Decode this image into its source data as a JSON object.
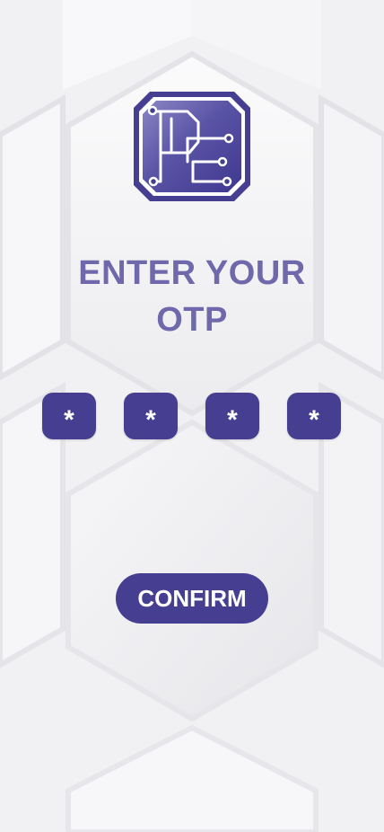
{
  "logo": {
    "icon": "pe-circuit-logo-icon",
    "color": "#463f91"
  },
  "title": {
    "line1": "ENTER YOUR",
    "line2": "OTP"
  },
  "otp": {
    "digits": [
      "*",
      "*",
      "*",
      "*"
    ]
  },
  "confirm_label": "CONFIRM",
  "colors": {
    "accent": "#463f91",
    "title": "#6f69ab",
    "background": "#f2f2f4"
  }
}
